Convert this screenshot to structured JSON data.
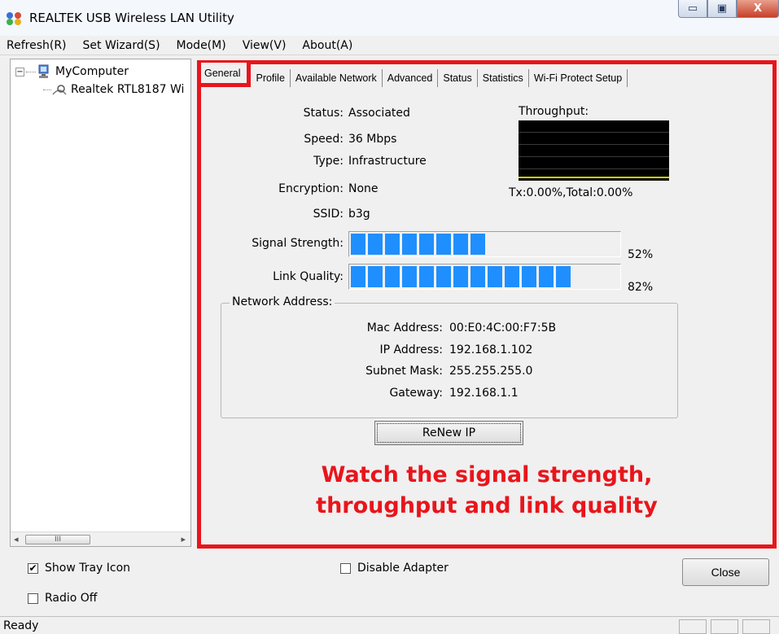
{
  "window": {
    "title": "REALTEK USB Wireless LAN Utility",
    "controls": {
      "minimize": "▭",
      "maximize": "▣",
      "close": "X"
    }
  },
  "menu": [
    "Refresh(R)",
    "Set Wizard(S)",
    "Mode(M)",
    "View(V)",
    "About(A)"
  ],
  "tree": {
    "expander": "−",
    "root": "MyComputer",
    "child": "Realtek RTL8187 Wi",
    "scroll_thumb": "III"
  },
  "tabs": [
    "General",
    "Profile",
    "Available Network",
    "Advanced",
    "Status",
    "Statistics",
    "Wi-Fi Protect Setup"
  ],
  "general": {
    "status_label": "Status:",
    "status_value": "Associated",
    "speed_label": "Speed:",
    "speed_value": "36 Mbps",
    "type_label": "Type:",
    "type_value": "Infrastructure",
    "encryption_label": "Encryption:",
    "encryption_value": "None",
    "ssid_label": "SSID:",
    "ssid_value": "b3g",
    "throughput_label": "Throughput:",
    "throughput_text": "Tx:0.00%,Total:0.00%",
    "signal_label": "Signal Strength:",
    "signal_percent": 52,
    "signal_text": "52%",
    "link_label": "Link Quality:",
    "link_percent": 82,
    "link_text": "82%",
    "network_address_label": "Network Address:",
    "mac_label": "Mac Address:",
    "mac_value": "00:E0:4C:00:F7:5B",
    "ip_label": "IP Address:",
    "ip_value": "192.168.1.102",
    "subnet_label": "Subnet Mask:",
    "subnet_value": "255.255.255.0",
    "gateway_label": "Gateway:",
    "gateway_value": "192.168.1.1",
    "renew_label": "ReNew IP"
  },
  "annotation": {
    "line1": "Watch the signal strength,",
    "line2": "throughput and link quality"
  },
  "bottom": {
    "show_tray": "Show Tray Icon",
    "show_tray_checked": true,
    "radio_off": "Radio Off",
    "radio_off_checked": false,
    "disable_adapter": "Disable Adapter",
    "disable_adapter_checked": false,
    "close_label": "Close"
  },
  "statusbar": {
    "text": "Ready"
  },
  "colors": {
    "highlight": "#e8151b",
    "meter": "#1f8fff"
  }
}
